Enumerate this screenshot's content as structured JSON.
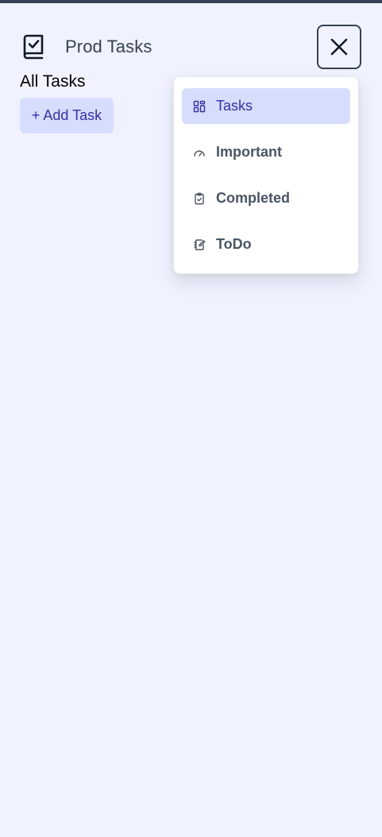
{
  "app": {
    "name": "Prod Tasks"
  },
  "page": {
    "title": "All Tasks"
  },
  "actions": {
    "add_task_label": "+ Add Task"
  },
  "nav_menu": {
    "items": [
      {
        "label": "Tasks",
        "icon": "grid-icon",
        "active": true
      },
      {
        "label": "Important",
        "icon": "gauge-icon",
        "active": false
      },
      {
        "label": "Completed",
        "icon": "clipboard-check-icon",
        "active": false
      },
      {
        "label": "ToDo",
        "icon": "notebook-edit-icon",
        "active": false
      }
    ]
  },
  "colors": {
    "background": "#f0f3ff",
    "accent_bg": "#d6ddfd",
    "accent_text": "#3730a3",
    "text_muted": "#4b5563"
  }
}
